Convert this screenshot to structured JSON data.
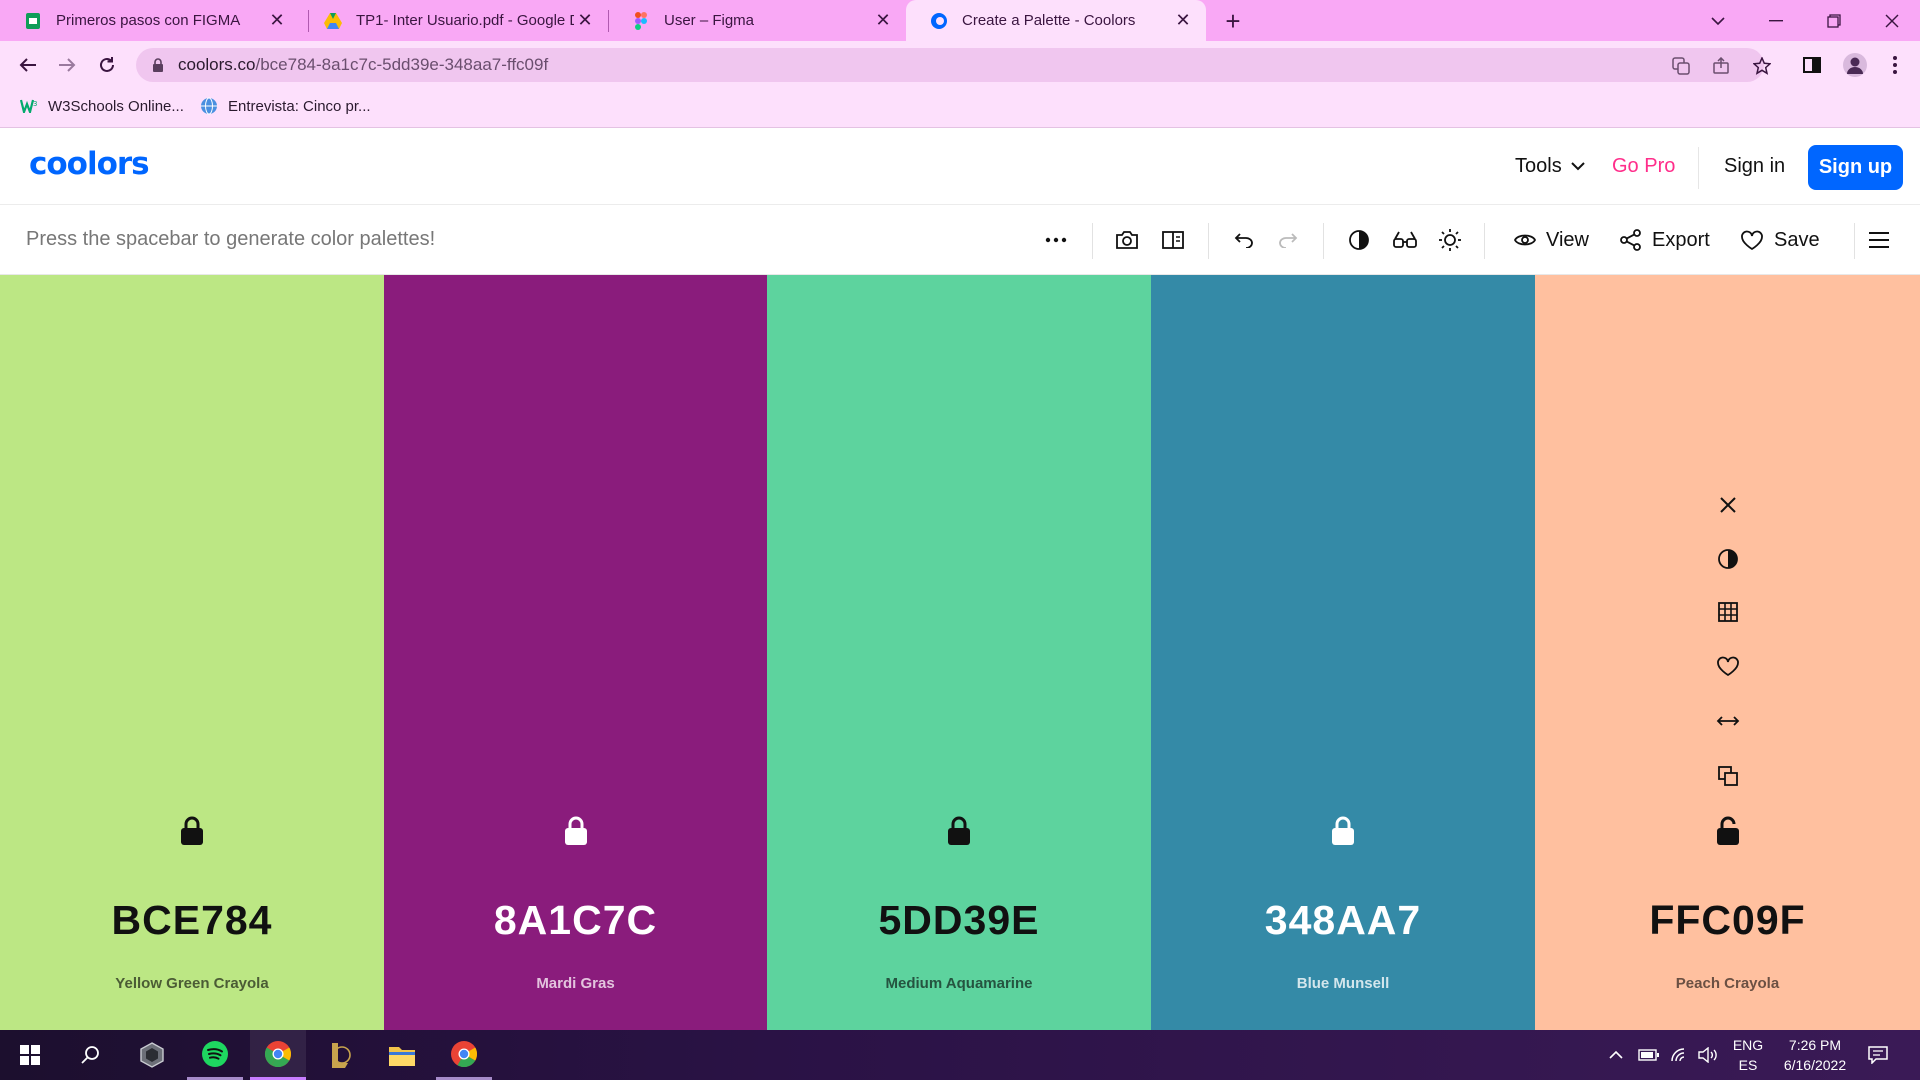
{
  "browser": {
    "tabs": [
      {
        "title": "Primeros pasos con FIGMA",
        "icon": "google-slides-icon"
      },
      {
        "title": "TP1- Inter Usuario.pdf - Google D",
        "icon": "google-drive-icon"
      },
      {
        "title": "User – Figma",
        "icon": "figma-icon"
      },
      {
        "title": "Create a Palette - Coolors",
        "icon": "coolors-icon"
      }
    ],
    "url_domain": "coolors.co",
    "url_path": "/bce784-8a1c7c-5dd39e-348aa7-ffc09f",
    "bookmarks": [
      {
        "label": "W3Schools Online...",
        "icon": "w3schools-icon"
      },
      {
        "label": "Entrevista: Cinco pr...",
        "icon": "globe-icon"
      }
    ]
  },
  "site": {
    "logo": "coolors",
    "nav": {
      "tools": "Tools",
      "go_pro": "Go Pro",
      "sign_in": "Sign in",
      "sign_up": "Sign up"
    },
    "toolbar": {
      "hint": "Press the spacebar to generate color palettes!",
      "view": "View",
      "export": "Export",
      "save": "Save"
    }
  },
  "palette": [
    {
      "hex": "BCE784",
      "name": "Yellow Green Crayola",
      "bg": "#bce784",
      "text": "#111111",
      "name_color": "#4b5c35"
    },
    {
      "hex": "8A1C7C",
      "name": "Mardi Gras",
      "bg": "#8a1c7c",
      "text": "#ffffff",
      "name_color": "#e3c4de"
    },
    {
      "hex": "5DD39E",
      "name": "Medium Aquamarine",
      "bg": "#5dd39e",
      "text": "#111111",
      "name_color": "#255440"
    },
    {
      "hex": "348AA7",
      "name": "Blue Munsell",
      "bg": "#348aa7",
      "text": "#ffffff",
      "name_color": "#d3e6ec"
    },
    {
      "hex": "FFC09F",
      "name": "Peach Crayola",
      "bg": "#ffc09f",
      "text": "#111111",
      "name_color": "#6b5043"
    }
  ],
  "taskbar": {
    "lang_top": "ENG",
    "lang_bottom": "ES",
    "time": "7:26 PM",
    "date": "6/16/2022"
  }
}
